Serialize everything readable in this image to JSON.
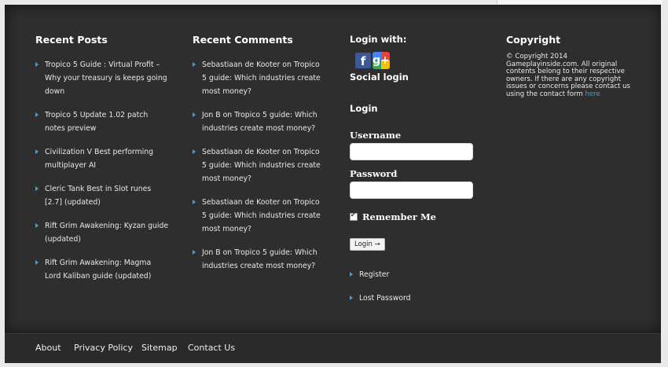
{
  "recent_posts": {
    "title": "Recent Posts",
    "items": [
      "Tropico 5 Guide : Virtual Profit – Why your treasury is keeps going down",
      "Tropico 5 Update 1.02 patch notes preview",
      "Civilization V Best performing multiplayer AI",
      "Cleric Tank Best in Slot runes [2.7] (updated)",
      "Rift Grim Awakening: Kyzan guide (updated)",
      "Rift Grim Awakening: Magma Lord Kaliban guide (updated)"
    ]
  },
  "recent_comments": {
    "title": "Recent Comments",
    "items": [
      "Sebastiaan de Kooter on Tropico 5 guide: Which industries create most money?",
      "Jon B on Tropico 5 guide: Which industries create most money?",
      "Sebastiaan de Kooter on Tropico 5 guide: Which industries create most money?",
      "Sebastiaan de Kooter on Tropico 5 guide: Which industries create most money?",
      "Jon B on Tropico 5 guide: Which industries create most money?"
    ]
  },
  "login": {
    "login_with": "Login with:",
    "social_login": "Social login",
    "heading": "Login",
    "username_label": "Username",
    "password_label": "Password",
    "remember_me": "Remember Me",
    "button": "Login →",
    "register": "Register",
    "lost_password": "Lost Password",
    "icons": [
      "facebook-icon",
      "google-plus-icon"
    ]
  },
  "copyright": {
    "title": "Copyright",
    "text": "© Copyright 2014 Gameplayinside.com. All original contents belong to their respective owners. If there are any copyright issues or concerns please contact us using the contact form",
    "link": "here"
  },
  "footer": {
    "links": [
      "About",
      "Privacy Policy",
      "Sitemap",
      "Contact Us"
    ]
  },
  "colors": {
    "background": "#2e2e2e",
    "accent": "#3fa4d8"
  }
}
